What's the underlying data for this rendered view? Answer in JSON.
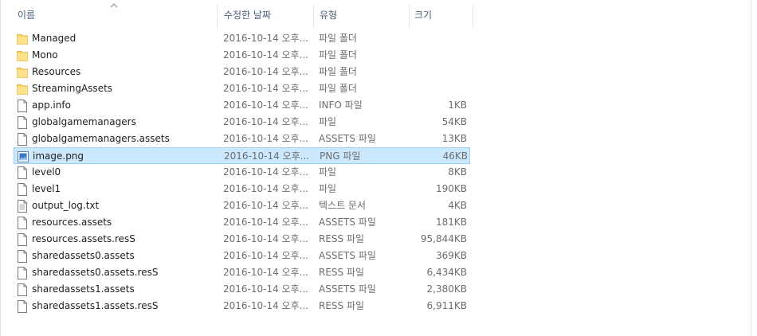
{
  "columns": {
    "name": "이름",
    "date": "수정한 날짜",
    "type": "유형",
    "size": "크기"
  },
  "files": [
    {
      "name": "Managed",
      "date": "2016-10-14 오후...",
      "type": "파일 폴더",
      "size": "",
      "icon": "folder-icon"
    },
    {
      "name": "Mono",
      "date": "2016-10-14 오후...",
      "type": "파일 폴더",
      "size": "",
      "icon": "folder-icon"
    },
    {
      "name": "Resources",
      "date": "2016-10-14 오후...",
      "type": "파일 폴더",
      "size": "",
      "icon": "folder-icon"
    },
    {
      "name": "StreamingAssets",
      "date": "2016-10-14 오후...",
      "type": "파일 폴더",
      "size": "",
      "icon": "folder-icon"
    },
    {
      "name": "app.info",
      "date": "2016-10-14 오후...",
      "type": "INFO 파일",
      "size": "1KB",
      "icon": "file-icon"
    },
    {
      "name": "globalgamemanagers",
      "date": "2016-10-14 오후...",
      "type": "파일",
      "size": "54KB",
      "icon": "file-icon"
    },
    {
      "name": "globalgamemanagers.assets",
      "date": "2016-10-14 오후...",
      "type": "ASSETS 파일",
      "size": "13KB",
      "icon": "file-icon"
    },
    {
      "name": "image.png",
      "date": "2016-10-14 오후...",
      "type": "PNG 파일",
      "size": "46KB",
      "icon": "image-file-icon",
      "selected": true
    },
    {
      "name": "level0",
      "date": "2016-10-14 오후...",
      "type": "파일",
      "size": "8KB",
      "icon": "file-icon"
    },
    {
      "name": "level1",
      "date": "2016-10-14 오후...",
      "type": "파일",
      "size": "190KB",
      "icon": "file-icon"
    },
    {
      "name": "output_log.txt",
      "date": "2016-10-14 오후...",
      "type": "텍스트 문서",
      "size": "4KB",
      "icon": "text-file-icon"
    },
    {
      "name": "resources.assets",
      "date": "2016-10-14 오후...",
      "type": "ASSETS 파일",
      "size": "181KB",
      "icon": "file-icon"
    },
    {
      "name": "resources.assets.resS",
      "date": "2016-10-14 오후...",
      "type": "RESS 파일",
      "size": "95,844KB",
      "icon": "file-icon"
    },
    {
      "name": "sharedassets0.assets",
      "date": "2016-10-14 오후...",
      "type": "ASSETS 파일",
      "size": "369KB",
      "icon": "file-icon"
    },
    {
      "name": "sharedassets0.assets.resS",
      "date": "2016-10-14 오후...",
      "type": "RESS 파일",
      "size": "6,434KB",
      "icon": "file-icon"
    },
    {
      "name": "sharedassets1.assets",
      "date": "2016-10-14 오후...",
      "type": "ASSETS 파일",
      "size": "2,380KB",
      "icon": "file-icon"
    },
    {
      "name": "sharedassets1.assets.resS",
      "date": "2016-10-14 오후...",
      "type": "RESS 파일",
      "size": "6,911KB",
      "icon": "file-icon"
    }
  ],
  "colors": {
    "selection_bg": "#cce8ff",
    "selection_border": "#99d1ff",
    "folder": "#ffd868",
    "header_text": "#4c607a"
  }
}
